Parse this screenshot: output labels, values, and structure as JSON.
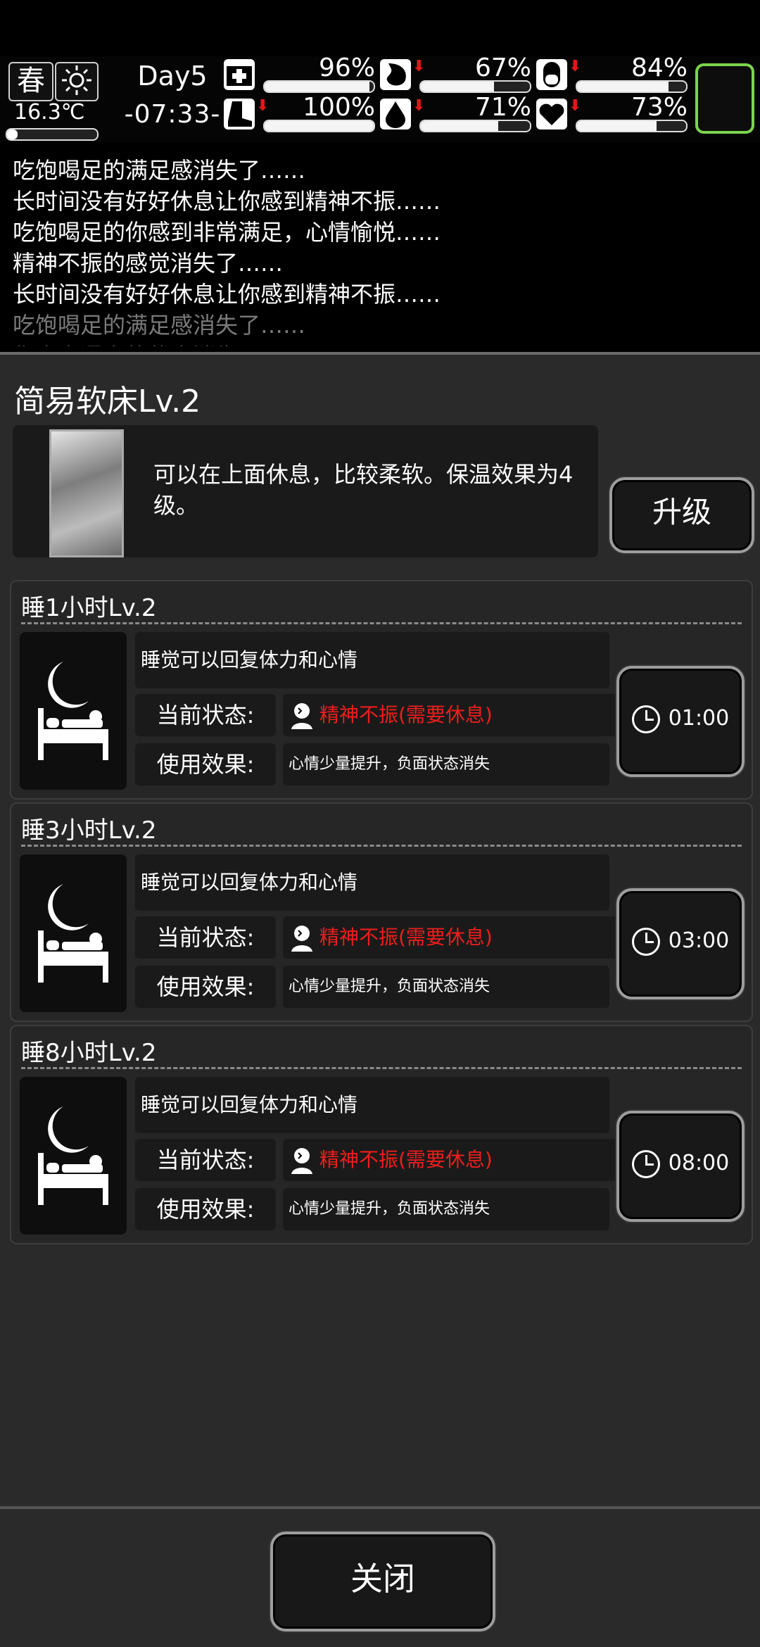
{
  "status": {
    "season": "春",
    "weather_icon": "sun-icon",
    "temperature": "16.3℃",
    "temperature_level": 0.12,
    "day": "Day5",
    "time": "-07:33-",
    "stats": [
      {
        "name": "health",
        "icon": "medkit-icon",
        "percent": "96%",
        "value": 96,
        "falling": false
      },
      {
        "name": "hunger",
        "icon": "stomach-icon",
        "percent": "67%",
        "value": 67,
        "falling": true
      },
      {
        "name": "bandage",
        "icon": "pill-icon",
        "percent": "84%",
        "value": 84,
        "falling": true
      },
      {
        "name": "stamina",
        "icon": "boot-icon",
        "percent": "100%",
        "value": 100,
        "falling": true
      },
      {
        "name": "thirst",
        "icon": "water-drop-icon",
        "percent": "71%",
        "value": 71,
        "falling": true
      },
      {
        "name": "mood",
        "icon": "heart-icon",
        "percent": "73%",
        "value": 73,
        "falling": true
      }
    ],
    "accent_color": "#7bd34e"
  },
  "log": [
    "吃饱喝足的满足感消失了……",
    "长时间没有好好休息让你感到精神不振……",
    "吃饱喝足的你感到非常满足，心情愉悦……",
    "精神不振的感觉消失了……",
    "长时间没有好好休息让你感到精神不振……",
    "吃饱喝足的满足感消失了……",
    "你全身通泰的状态消失了"
  ],
  "item": {
    "title": "简易软床Lv.2",
    "description": "可以在上面休息，比较柔软。保温效果为4级。",
    "upgrade_label": "升级"
  },
  "options": [
    {
      "title": "睡1小时Lv.2",
      "desc": "睡觉可以回复体力和心情",
      "state_label": "当前状态:",
      "state_value": "精神不振(需要休息)",
      "effect_label": "使用效果:",
      "effect_value": "心情少量提升，负面状态消失",
      "time": "01:00"
    },
    {
      "title": "睡3小时Lv.2",
      "desc": "睡觉可以回复体力和心情",
      "state_label": "当前状态:",
      "state_value": "精神不振(需要休息)",
      "effect_label": "使用效果:",
      "effect_value": "心情少量提升，负面状态消失",
      "time": "03:00"
    },
    {
      "title": "睡8小时Lv.2",
      "desc": "睡觉可以回复体力和心情",
      "state_label": "当前状态:",
      "state_value": "精神不振(需要休息)",
      "effect_label": "使用效果:",
      "effect_value": "心情少量提升，负面状态消失",
      "time": "08:00"
    }
  ],
  "close_label": "关闭",
  "state_color": "#ee1d1d"
}
